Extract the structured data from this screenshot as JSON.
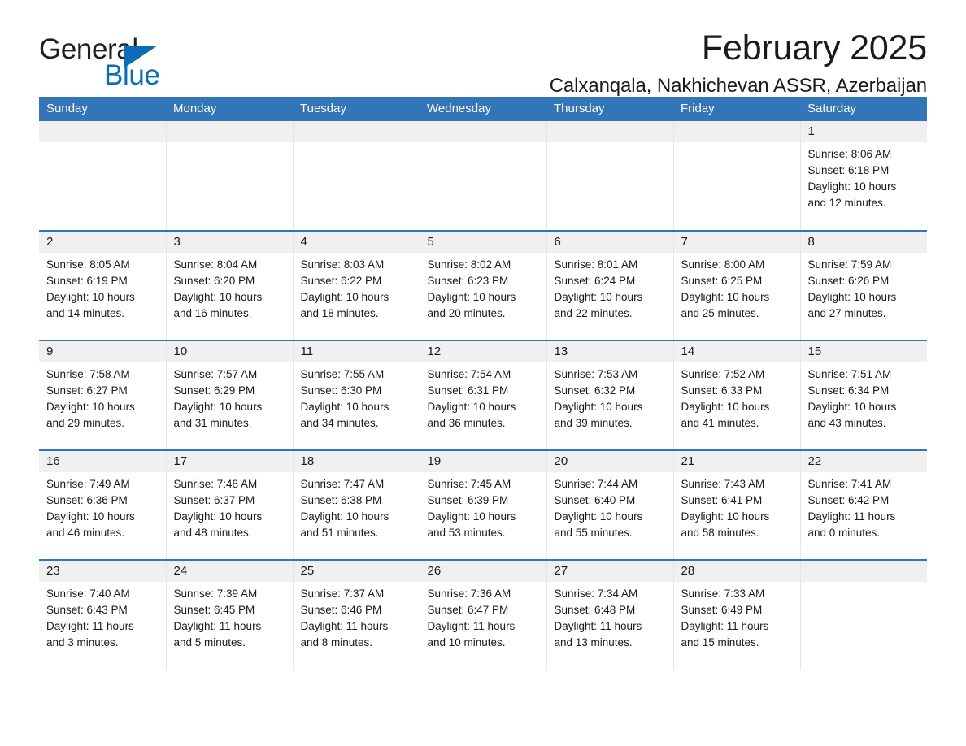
{
  "brand": {
    "logo_line1": "General",
    "logo_line2": "Blue",
    "triangle_icon": "triangle-icon",
    "accent_blue": "#0b6db7"
  },
  "header": {
    "title": "February 2025",
    "subtitle": "Calxanqala, Nakhichevan ASSR, Azerbaijan",
    "header_bg": "#3275b8"
  },
  "calendar": {
    "weekday_headers": [
      "Sunday",
      "Monday",
      "Tuesday",
      "Wednesday",
      "Thursday",
      "Friday",
      "Saturday"
    ],
    "weeks": [
      [
        {
          "day": "",
          "lines": []
        },
        {
          "day": "",
          "lines": []
        },
        {
          "day": "",
          "lines": []
        },
        {
          "day": "",
          "lines": []
        },
        {
          "day": "",
          "lines": []
        },
        {
          "day": "",
          "lines": []
        },
        {
          "day": "1",
          "lines": [
            "Sunrise: 8:06 AM",
            "Sunset: 6:18 PM",
            "Daylight: 10 hours",
            "and 12 minutes."
          ]
        }
      ],
      [
        {
          "day": "2",
          "lines": [
            "Sunrise: 8:05 AM",
            "Sunset: 6:19 PM",
            "Daylight: 10 hours",
            "and 14 minutes."
          ]
        },
        {
          "day": "3",
          "lines": [
            "Sunrise: 8:04 AM",
            "Sunset: 6:20 PM",
            "Daylight: 10 hours",
            "and 16 minutes."
          ]
        },
        {
          "day": "4",
          "lines": [
            "Sunrise: 8:03 AM",
            "Sunset: 6:22 PM",
            "Daylight: 10 hours",
            "and 18 minutes."
          ]
        },
        {
          "day": "5",
          "lines": [
            "Sunrise: 8:02 AM",
            "Sunset: 6:23 PM",
            "Daylight: 10 hours",
            "and 20 minutes."
          ]
        },
        {
          "day": "6",
          "lines": [
            "Sunrise: 8:01 AM",
            "Sunset: 6:24 PM",
            "Daylight: 10 hours",
            "and 22 minutes."
          ]
        },
        {
          "day": "7",
          "lines": [
            "Sunrise: 8:00 AM",
            "Sunset: 6:25 PM",
            "Daylight: 10 hours",
            "and 25 minutes."
          ]
        },
        {
          "day": "8",
          "lines": [
            "Sunrise: 7:59 AM",
            "Sunset: 6:26 PM",
            "Daylight: 10 hours",
            "and 27 minutes."
          ]
        }
      ],
      [
        {
          "day": "9",
          "lines": [
            "Sunrise: 7:58 AM",
            "Sunset: 6:27 PM",
            "Daylight: 10 hours",
            "and 29 minutes."
          ]
        },
        {
          "day": "10",
          "lines": [
            "Sunrise: 7:57 AM",
            "Sunset: 6:29 PM",
            "Daylight: 10 hours",
            "and 31 minutes."
          ]
        },
        {
          "day": "11",
          "lines": [
            "Sunrise: 7:55 AM",
            "Sunset: 6:30 PM",
            "Daylight: 10 hours",
            "and 34 minutes."
          ]
        },
        {
          "day": "12",
          "lines": [
            "Sunrise: 7:54 AM",
            "Sunset: 6:31 PM",
            "Daylight: 10 hours",
            "and 36 minutes."
          ]
        },
        {
          "day": "13",
          "lines": [
            "Sunrise: 7:53 AM",
            "Sunset: 6:32 PM",
            "Daylight: 10 hours",
            "and 39 minutes."
          ]
        },
        {
          "day": "14",
          "lines": [
            "Sunrise: 7:52 AM",
            "Sunset: 6:33 PM",
            "Daylight: 10 hours",
            "and 41 minutes."
          ]
        },
        {
          "day": "15",
          "lines": [
            "Sunrise: 7:51 AM",
            "Sunset: 6:34 PM",
            "Daylight: 10 hours",
            "and 43 minutes."
          ]
        }
      ],
      [
        {
          "day": "16",
          "lines": [
            "Sunrise: 7:49 AM",
            "Sunset: 6:36 PM",
            "Daylight: 10 hours",
            "and 46 minutes."
          ]
        },
        {
          "day": "17",
          "lines": [
            "Sunrise: 7:48 AM",
            "Sunset: 6:37 PM",
            "Daylight: 10 hours",
            "and 48 minutes."
          ]
        },
        {
          "day": "18",
          "lines": [
            "Sunrise: 7:47 AM",
            "Sunset: 6:38 PM",
            "Daylight: 10 hours",
            "and 51 minutes."
          ]
        },
        {
          "day": "19",
          "lines": [
            "Sunrise: 7:45 AM",
            "Sunset: 6:39 PM",
            "Daylight: 10 hours",
            "and 53 minutes."
          ]
        },
        {
          "day": "20",
          "lines": [
            "Sunrise: 7:44 AM",
            "Sunset: 6:40 PM",
            "Daylight: 10 hours",
            "and 55 minutes."
          ]
        },
        {
          "day": "21",
          "lines": [
            "Sunrise: 7:43 AM",
            "Sunset: 6:41 PM",
            "Daylight: 10 hours",
            "and 58 minutes."
          ]
        },
        {
          "day": "22",
          "lines": [
            "Sunrise: 7:41 AM",
            "Sunset: 6:42 PM",
            "Daylight: 11 hours",
            "and 0 minutes."
          ]
        }
      ],
      [
        {
          "day": "23",
          "lines": [
            "Sunrise: 7:40 AM",
            "Sunset: 6:43 PM",
            "Daylight: 11 hours",
            "and 3 minutes."
          ]
        },
        {
          "day": "24",
          "lines": [
            "Sunrise: 7:39 AM",
            "Sunset: 6:45 PM",
            "Daylight: 11 hours",
            "and 5 minutes."
          ]
        },
        {
          "day": "25",
          "lines": [
            "Sunrise: 7:37 AM",
            "Sunset: 6:46 PM",
            "Daylight: 11 hours",
            "and 8 minutes."
          ]
        },
        {
          "day": "26",
          "lines": [
            "Sunrise: 7:36 AM",
            "Sunset: 6:47 PM",
            "Daylight: 11 hours",
            "and 10 minutes."
          ]
        },
        {
          "day": "27",
          "lines": [
            "Sunrise: 7:34 AM",
            "Sunset: 6:48 PM",
            "Daylight: 11 hours",
            "and 13 minutes."
          ]
        },
        {
          "day": "28",
          "lines": [
            "Sunrise: 7:33 AM",
            "Sunset: 6:49 PM",
            "Daylight: 11 hours",
            "and 15 minutes."
          ]
        },
        {
          "day": "",
          "lines": []
        }
      ]
    ]
  }
}
